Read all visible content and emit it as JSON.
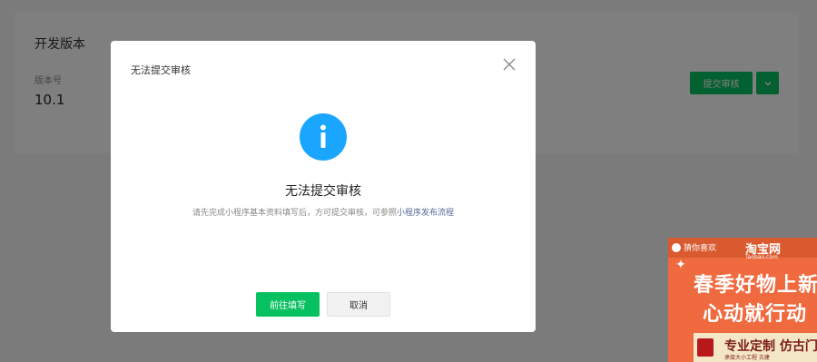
{
  "page": {
    "card_title": "开发版本",
    "version_label": "版本号",
    "version_value": "10.1",
    "submit_label": "提交审核"
  },
  "modal": {
    "title": "无法提交审核",
    "message_title": "无法提交审核",
    "message_desc": "请先完成小程序基本资料填写后，方可提交审核，可参照",
    "message_link": "小程序发布流程",
    "primary_label": "前往填写",
    "cancel_label": "取消"
  },
  "ad": {
    "guess_label": "猜你喜欢",
    "logo_text": "淘宝网",
    "logo_sub": "Taobao.com",
    "line1": "春季好物上新",
    "line2": "心动就行动",
    "strip_text": "专业定制 仿古门",
    "strip_sub": "承接大小工程 古建"
  },
  "colors": {
    "primary": "#07c160",
    "info": "#1aa6ff",
    "link": "#576b95",
    "mask": "rgba(0,0,0,0.5)"
  }
}
